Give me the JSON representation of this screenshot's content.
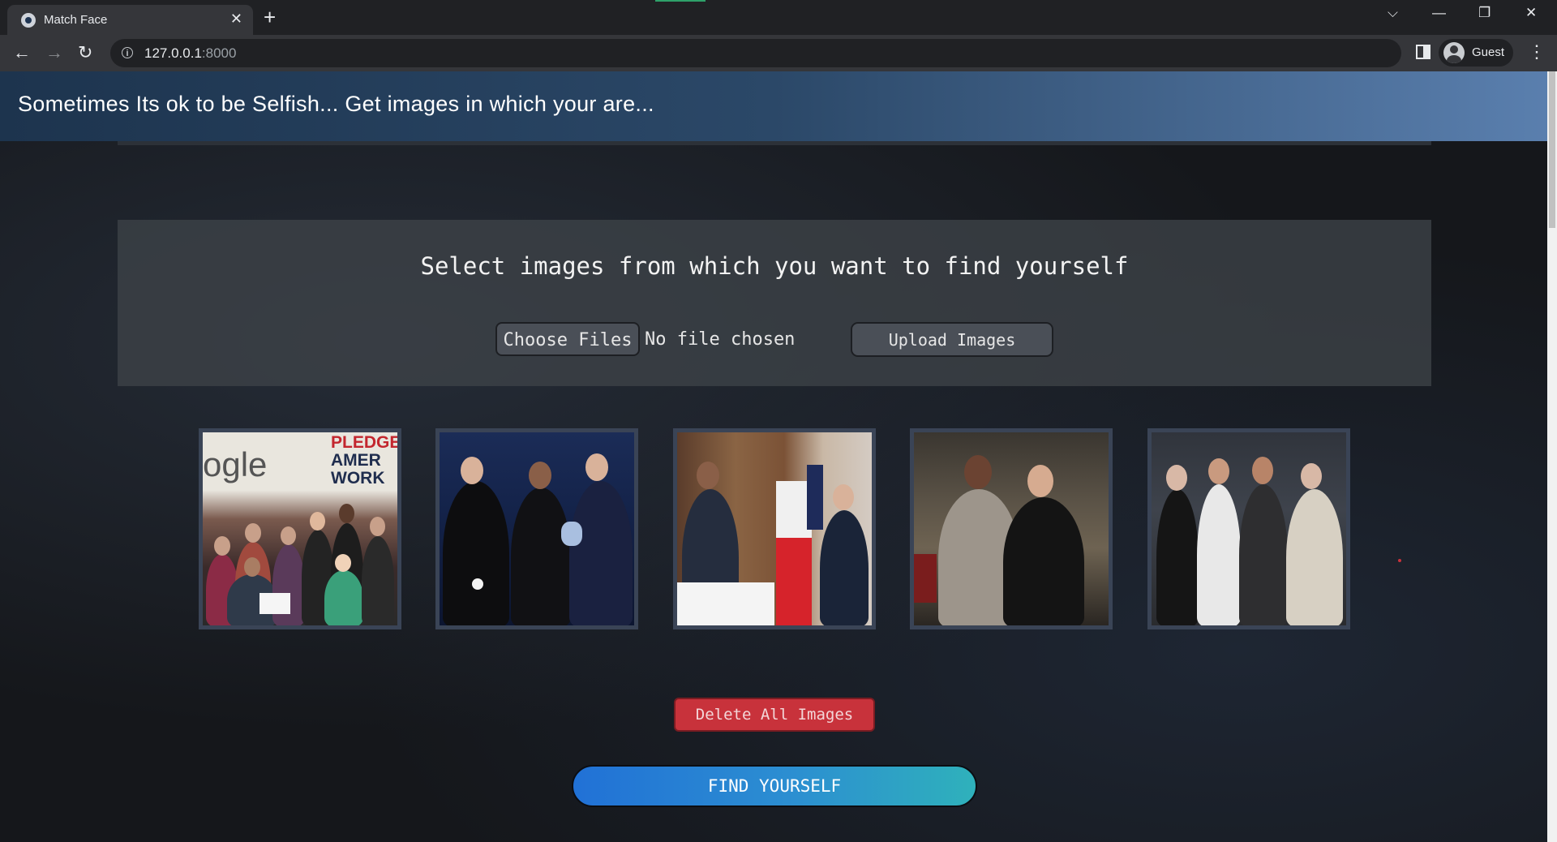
{
  "browser": {
    "tab_title": "Match Face",
    "tab_close": "✕",
    "new_tab": "+",
    "url_host": "127.0.0.1",
    "url_port": ":8000",
    "profile_label": "Guest",
    "window_controls": {
      "tab_search": "⌵",
      "minimize": "—",
      "restore": "❐",
      "close": "✕"
    },
    "nav": {
      "back": "←",
      "forward": "→",
      "reload": "↻"
    },
    "info_glyph": "i",
    "menu_glyph": "⋮"
  },
  "page": {
    "header_title": "Sometimes Its ok to be Selfish... Get images in which your are...",
    "upload": {
      "heading": "Select images from which you want to find yourself",
      "choose_files_label": "Choose Files",
      "file_status": "No file chosen",
      "upload_button_label": "Upload Images"
    },
    "images": [
      {
        "name": "uploaded-image-1",
        "overlay_text": "ogle",
        "sign_line1": "PLEDGE",
        "sign_line2": "AMER",
        "sign_line3": "WORK"
      },
      {
        "name": "uploaded-image-2"
      },
      {
        "name": "uploaded-image-3"
      },
      {
        "name": "uploaded-image-4"
      },
      {
        "name": "uploaded-image-5"
      }
    ],
    "delete_button_label": "Delete All Images",
    "find_button_label": "FIND YOURSELF"
  },
  "colors": {
    "header_gradient_start": "#1d344e",
    "header_gradient_end": "#5a7fae",
    "delete_button": "#c8323b",
    "find_button_start": "#2171d6",
    "find_button_end": "#2fb1bb"
  }
}
